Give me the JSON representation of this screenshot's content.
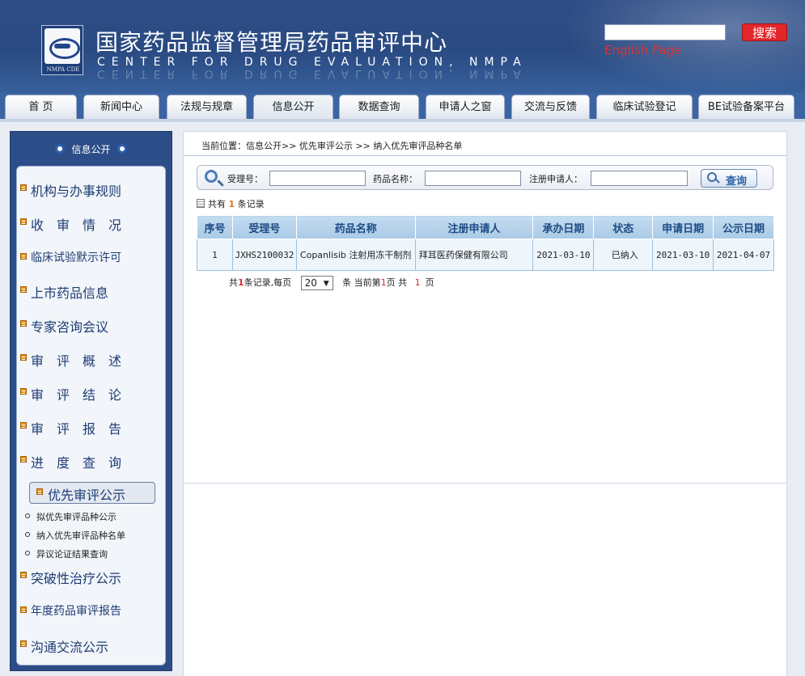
{
  "header": {
    "title_cn": "国家药品监督管理局药品审评中心",
    "title_en": "CENTER FOR DRUG EVALUATION, NMPA",
    "logo_caption": "NMPA CDE",
    "search_button": "搜索",
    "english_link": "English Page"
  },
  "nav": {
    "tabs": [
      "首  页",
      "新闻中心",
      "法规与规章",
      "信息公开",
      "数据查询",
      "申请人之窗",
      "交流与反馈",
      "临床试验登记",
      "BE试验备案平台"
    ],
    "active": "信息公开"
  },
  "sidebar": {
    "heading": "信息公开",
    "items": [
      "机构与办事规则",
      "收　审　情　况",
      "临床试验默示许可",
      "上市药品信息",
      "专家咨询会议",
      "审　评　概　述",
      "审　评　结　论",
      "审　评　报　告",
      "进　度　查　询",
      "优先审评公示",
      "突破性治疗公示",
      "年度药品审评报告",
      "沟通交流公示"
    ],
    "subitems": [
      "拟优先审评品种公示",
      "纳入优先审评品种名单",
      "异议论证结果查询"
    ]
  },
  "content": {
    "breadcrumb": "当前位置：信息公开>> 优先审评公示 >> 纳入优先审评品种名单",
    "search": {
      "label_accept": "受理号：",
      "label_drug": "药品名称：",
      "label_applicant": "注册申请人：",
      "query_button": "查询"
    },
    "count_prefix": "共有",
    "count_value": "1",
    "count_suffix": "条记录",
    "table": {
      "headers": [
        "序号",
        "受理号",
        "药品名称",
        "注册申请人",
        "承办日期",
        "状态",
        "申请日期",
        "公示日期"
      ],
      "rows": [
        [
          "1",
          "JXHS2100032",
          "Copanlisib 注射用冻干制剂",
          "拜耳医药保健有限公司",
          "2021-03-10",
          "已纳入",
          "2021-03-10",
          "2021-04-07"
        ]
      ]
    },
    "pager": {
      "prefix": "共",
      "total": "1",
      "mid": "条记录,每页",
      "per_page": "20",
      "after_select": "条 当前第",
      "current": "1",
      "page_of": "页 共",
      "pages": "1",
      "suffix": "页"
    }
  }
}
